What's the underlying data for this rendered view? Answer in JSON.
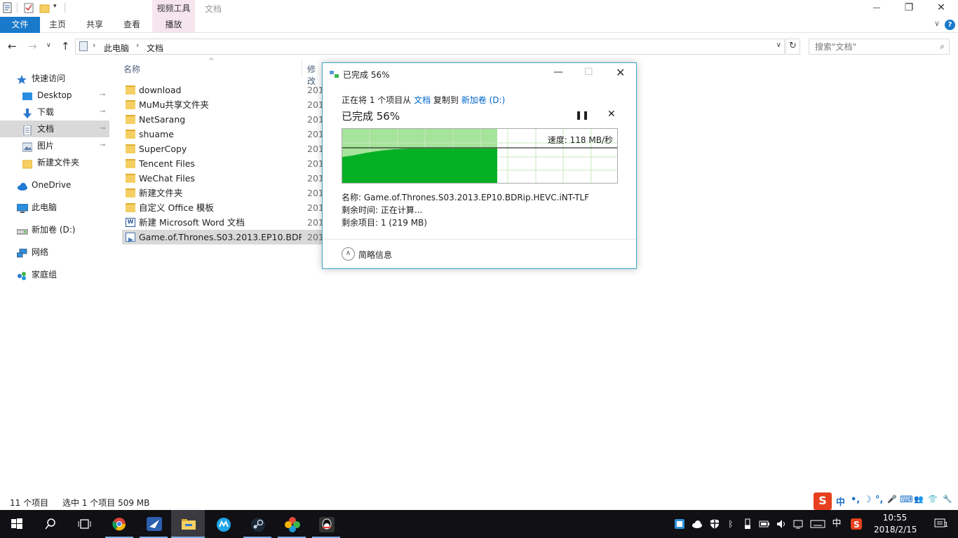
{
  "window": {
    "title": "文档",
    "context_tab": "视频工具",
    "min": "—",
    "max": "❐",
    "close": "✕"
  },
  "ribbon": {
    "tabs": [
      "文件",
      "主页",
      "共享",
      "查看",
      "播放"
    ],
    "expand": "∨",
    "help": "?"
  },
  "address": {
    "crumbs": [
      "此电脑",
      "文档"
    ],
    "sep": "›",
    "back": "←",
    "forward": "→",
    "recent": "∨",
    "up": "↑",
    "dropdown": "∨",
    "refresh": "↻"
  },
  "search": {
    "placeholder": "搜索\"文档\"",
    "icon": "⌕"
  },
  "nav": {
    "items": [
      {
        "label": "快速访问",
        "icon": "star-icon"
      },
      {
        "label": "Desktop",
        "icon": "desktop-icon",
        "pinned": true
      },
      {
        "label": "下载",
        "icon": "download-icon",
        "pinned": true
      },
      {
        "label": "文档",
        "icon": "documents-icon",
        "pinned": true,
        "selected": true
      },
      {
        "label": "图片",
        "icon": "pictures-icon",
        "pinned": true
      },
      {
        "label": "新建文件夹",
        "icon": "folder-icon"
      },
      {
        "label": "OneDrive",
        "icon": "onedrive-icon"
      },
      {
        "label": "此电脑",
        "icon": "pc-icon"
      },
      {
        "label": "新加卷 (D:)",
        "icon": "drive-icon"
      },
      {
        "label": "网络",
        "icon": "network-icon"
      },
      {
        "label": "家庭组",
        "icon": "homegroup-icon"
      }
    ],
    "pin_glyph": "📌"
  },
  "filelist": {
    "columns": [
      "名称",
      "修改"
    ],
    "sort_indicator": "^",
    "files": [
      {
        "name": "download",
        "date": "201",
        "type": "folder"
      },
      {
        "name": "MuMu共享文件夹",
        "date": "201",
        "type": "folder"
      },
      {
        "name": "NetSarang",
        "date": "201",
        "type": "folder"
      },
      {
        "name": "shuame",
        "date": "201",
        "type": "folder"
      },
      {
        "name": "SuperCopy",
        "date": "201",
        "type": "folder"
      },
      {
        "name": "Tencent Files",
        "date": "201",
        "type": "folder"
      },
      {
        "name": "WeChat Files",
        "date": "201",
        "type": "folder"
      },
      {
        "name": "新建文件夹",
        "date": "201",
        "type": "folder"
      },
      {
        "name": "自定义 Office 模板",
        "date": "201",
        "type": "folder"
      },
      {
        "name": "新建 Microsoft Word 文档",
        "date": "201",
        "type": "word"
      },
      {
        "name": "Game.of.Thrones.S03.2013.EP10.BDRi...",
        "date": "201",
        "type": "video",
        "selected": true
      }
    ]
  },
  "status": {
    "count": "11 个项目",
    "selected": "选中 1 个项目  509 MB"
  },
  "dialog": {
    "title": "已完成 56%",
    "desc_prefix": "正在将 1 个项目从 ",
    "desc_source": "文档",
    "desc_mid": " 复制到 ",
    "desc_target": "新加卷 (D:)",
    "progress_text": "已完成 56%",
    "progress": 0.56,
    "pause": "❚❚",
    "cancel": "✕",
    "speed": "速度: 118 MB/秒",
    "name_line": "名称: Game.of.Thrones.S03.2013.EP10.BDRip.HEVC.iNT-TLF",
    "time_line": "剩余时间: 正在计算...",
    "items_line": "剩余项目: 1 (219 MB)",
    "less_info": "简略信息",
    "less_glyph": "∧",
    "min": "—",
    "max": "☐",
    "close": "✕"
  },
  "ime": {
    "logo": "S",
    "items": [
      "中",
      "•,",
      "☽",
      "°,",
      "🎤",
      "⌨",
      "👥",
      "👕",
      "🔧"
    ]
  },
  "taskbar": {
    "apps": [
      "start-icon",
      "search-icon",
      "task-view-icon",
      "chrome-icon",
      "feiq-icon",
      "file-explorer-icon",
      "mumu-icon",
      "steam-icon",
      "game-center-icon",
      "qq-icon"
    ],
    "ime_lang": "中",
    "clock_time": "10:55",
    "clock_date": "2018/2/15",
    "notification_count": "1"
  },
  "colors": {
    "accent": "#1979ca",
    "progress_fill": "#06b025",
    "progress_bg": "#a6e39b",
    "dialog_border": "#3aa7c8",
    "link": "#0066cc"
  }
}
